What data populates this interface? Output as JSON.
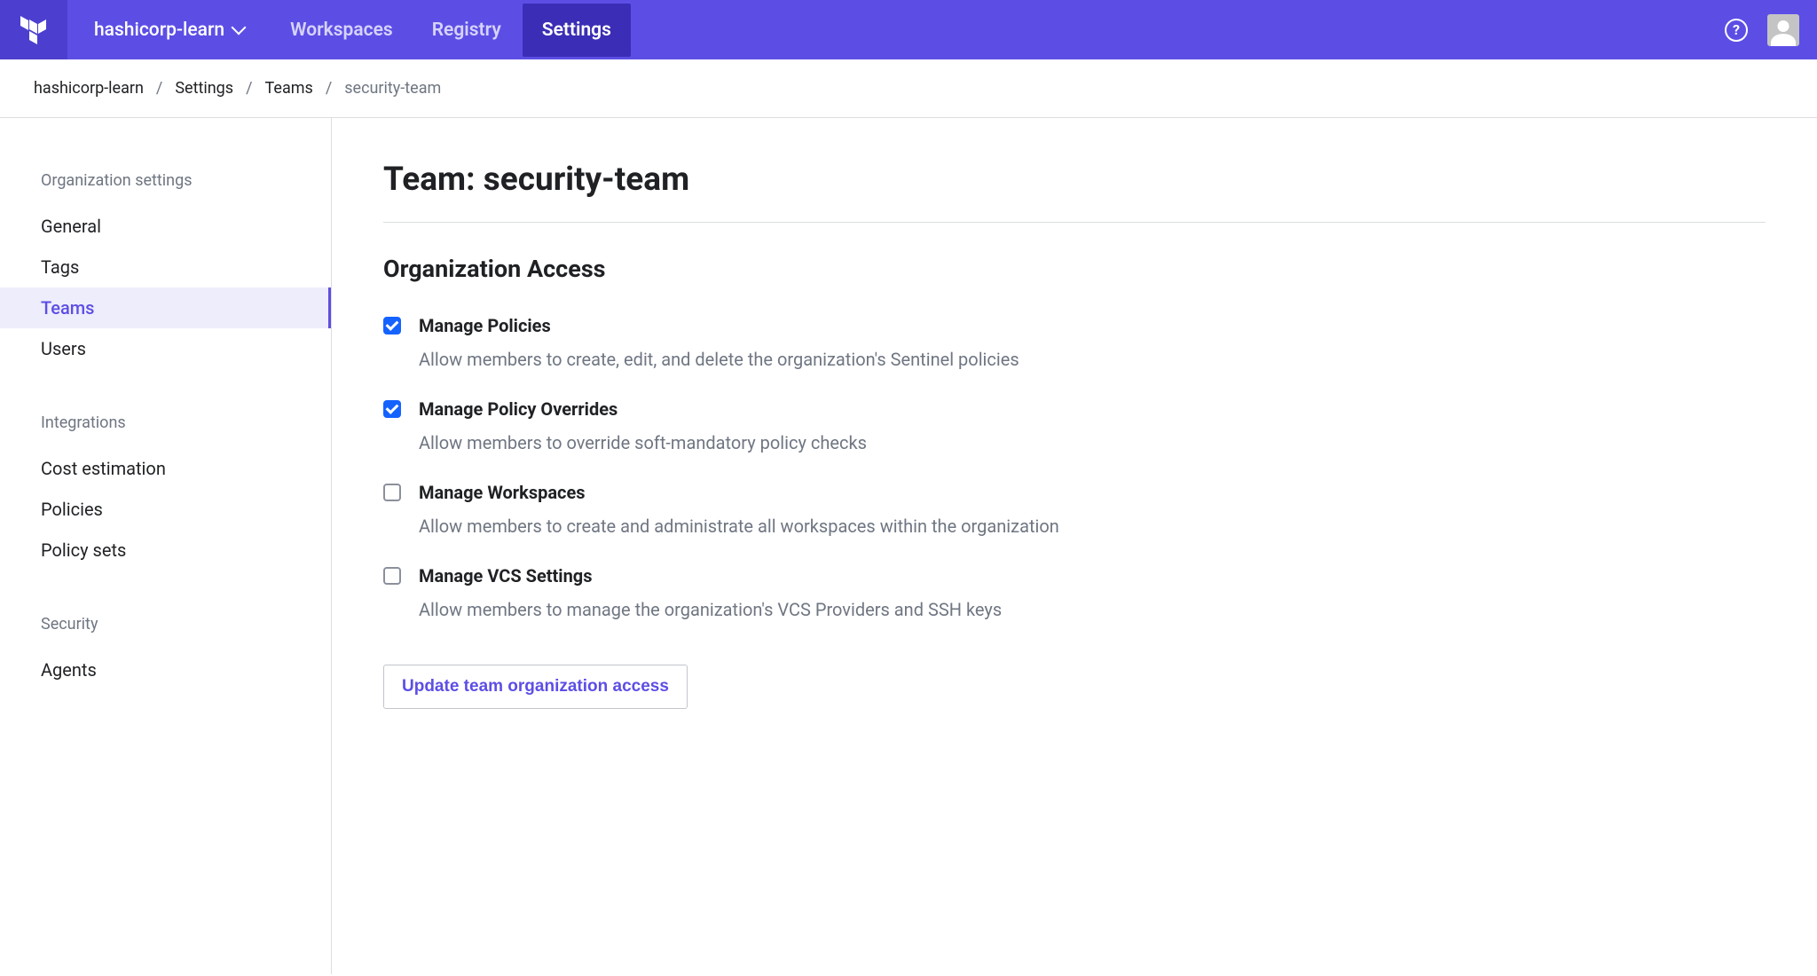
{
  "header": {
    "org_name": "hashicorp-learn",
    "nav": {
      "workspaces": "Workspaces",
      "registry": "Registry",
      "settings": "Settings"
    }
  },
  "breadcrumb": {
    "org": "hashicorp-learn",
    "settings": "Settings",
    "teams": "Teams",
    "current": "security-team"
  },
  "sidebar": {
    "sections": [
      {
        "title": "Organization settings",
        "items": [
          "General",
          "Tags",
          "Teams",
          "Users"
        ]
      },
      {
        "title": "Integrations",
        "items": [
          "Cost estimation",
          "Policies",
          "Policy sets"
        ]
      },
      {
        "title": "Security",
        "items": [
          "Agents"
        ]
      }
    ]
  },
  "page": {
    "title": "Team: security-team",
    "section_title": "Organization Access",
    "permissions": [
      {
        "title": "Manage Policies",
        "desc": "Allow members to create, edit, and delete the organization's Sentinel policies",
        "checked": true
      },
      {
        "title": "Manage Policy Overrides",
        "desc": "Allow members to override soft-mandatory policy checks",
        "checked": true
      },
      {
        "title": "Manage Workspaces",
        "desc": "Allow members to create and administrate all workspaces within the organization",
        "checked": false
      },
      {
        "title": "Manage VCS Settings",
        "desc": "Allow members to manage the organization's VCS Providers and SSH keys",
        "checked": false
      }
    ],
    "update_button": "Update team organization access"
  }
}
